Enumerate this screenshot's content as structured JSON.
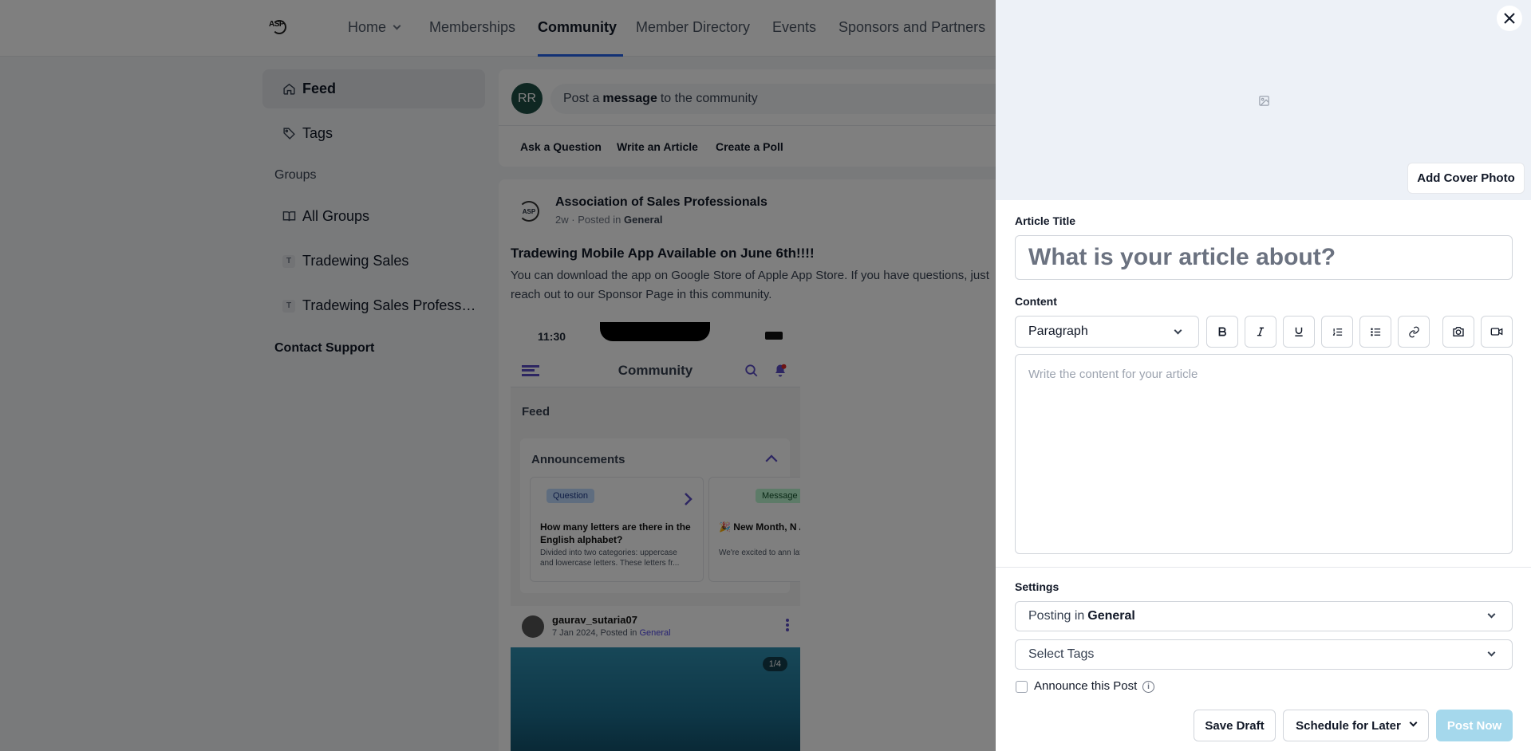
{
  "nav": {
    "logo_text": "ASP",
    "items": [
      "Home",
      "Memberships",
      "Community",
      "Member Directory",
      "Events",
      "Sponsors and Partners"
    ],
    "active": "Community"
  },
  "sidebar": {
    "feed": "Feed",
    "tags": "Tags",
    "groups_heading": "Groups",
    "all_groups": "All Groups",
    "group_items": [
      {
        "badge": "T",
        "label": "Tradewing Sales"
      },
      {
        "badge": "T",
        "label": "Tradewing Sales Profess…"
      }
    ],
    "contact_support": "Contact Support"
  },
  "composer": {
    "avatar": "RR",
    "placeholder_pre": "Post a ",
    "placeholder_bold": "message",
    "placeholder_post": " to the community",
    "actions": [
      "Ask a Question",
      "Write an Article",
      "Create a Poll"
    ]
  },
  "post": {
    "author": "Association of Sales Professionals",
    "age": "2w",
    "posted_in_label": "· Posted in",
    "group": "General",
    "title": "Tradewing Mobile App Available on June 6th!!!!",
    "body": "You can download the app on Google Store of Apple App Store. If you have questions, just reach out to our Sponsor Page in this community."
  },
  "phone": {
    "time": "11:30",
    "title": "Community",
    "feed": "Feed",
    "announcements": "Announcements",
    "card1": {
      "tag": "Question",
      "title": "How many letters are there in the English alphabet?",
      "text": "Divided into two categories: uppercase and lowercase letters. These letters fr..."
    },
    "card2": {
      "tag": "Message",
      "title": "🎉 New Month, N Alert! 🔔",
      "text": "We're excited to ann latest post for this m"
    },
    "author": "gaurav_sutaria07",
    "author_meta": "7 Jan 2024, Posted in",
    "author_group": "General",
    "image_count": "1/4"
  },
  "drawer": {
    "add_cover_photo": "Add Cover Photo",
    "article_title_label": "Article Title",
    "article_title_placeholder": "What is your article about?",
    "content_label": "Content",
    "format_select": "Paragraph",
    "toolbar_icons": [
      "bold-icon",
      "italic-icon",
      "underline-icon",
      "ordered-list-icon",
      "bullet-list-icon",
      "link-icon",
      "camera-icon",
      "video-icon"
    ],
    "content_placeholder": "Write the content for your article",
    "settings_label": "Settings",
    "posting_in_label": "Posting in",
    "posting_in_value": "General",
    "select_tags": "Select Tags",
    "announce_label": "Announce this Post",
    "save_draft": "Save Draft",
    "schedule": "Schedule for Later",
    "post_now": "Post Now"
  },
  "colors": {
    "overlay": "#000000",
    "accent": "#2563eb",
    "cover_bg": "#edf1f7",
    "post_now_disabled": "#a5d8ec",
    "avatar_bg": "#1f4f45"
  }
}
